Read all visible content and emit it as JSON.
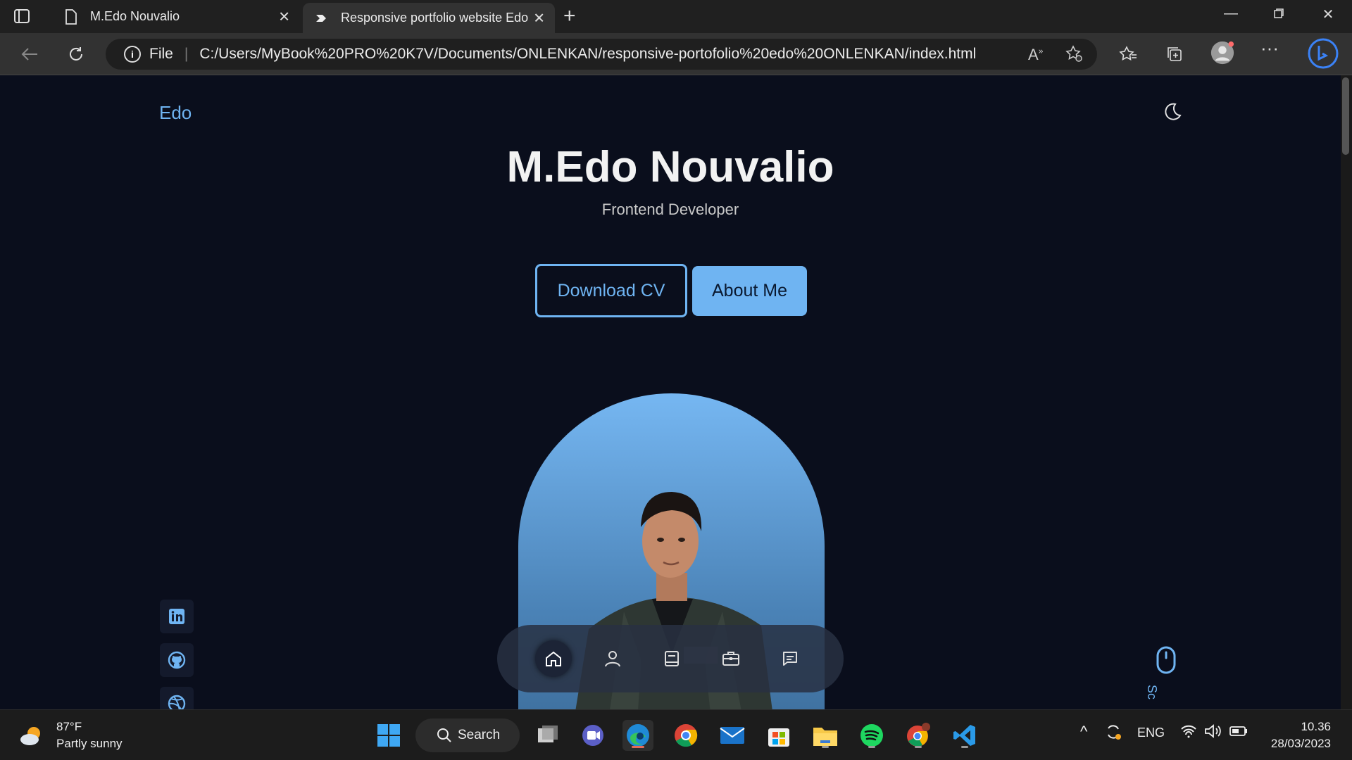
{
  "browser": {
    "tabs": [
      {
        "label": "M.Edo Nouvalio",
        "active": false
      },
      {
        "label": "Responsive portfolio website Edo",
        "active": true
      }
    ],
    "address": {
      "scheme": "File",
      "url": "C:/Users/MyBook%20PRO%20K7V/Documents/ONLENKAN/responsive-portofolio%20edo%20ONLENKAN/index.html"
    }
  },
  "page": {
    "logo": "Edo",
    "name": "M.Edo Nouvalio",
    "role": "Frontend Developer",
    "buttons": {
      "download_cv": "Download CV",
      "about_me": "About Me"
    },
    "scroll_text": "Sc",
    "accent_color": "#6fb4f2",
    "background_color": "#0a0e1c"
  },
  "taskbar": {
    "weather": {
      "temp": "87°F",
      "desc": "Partly sunny"
    },
    "search_label": "Search",
    "language": "ENG",
    "time": "10.36",
    "date": "28/03/2023"
  }
}
